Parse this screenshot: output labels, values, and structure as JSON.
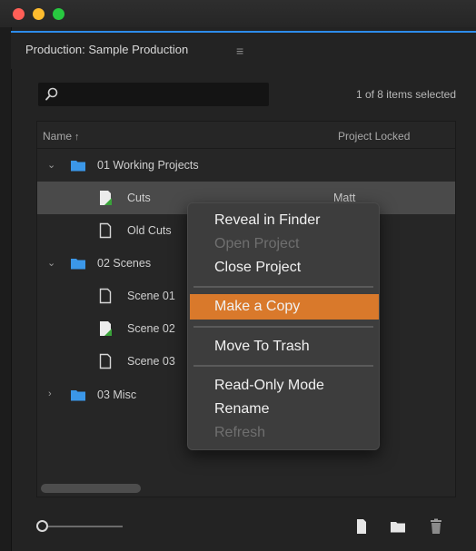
{
  "window": {
    "controls": [
      "close",
      "minimize",
      "zoom"
    ]
  },
  "panel": {
    "title": "Production: Sample Production",
    "menu_icon": "hamburger-menu-icon"
  },
  "search": {
    "placeholder": "",
    "icon": "search-icon"
  },
  "selection_status": "1 of 8 items selected",
  "columns": {
    "name": "Name",
    "name_sort": "↑",
    "locked": "Project Locked"
  },
  "tree": [
    {
      "label": "01 Working Projects",
      "type": "folder",
      "expanded": true,
      "locked": ""
    },
    {
      "label": "Cuts",
      "type": "project-open",
      "locked": "Matt",
      "selected": true
    },
    {
      "label": "Old Cuts",
      "type": "project",
      "locked": ""
    },
    {
      "label": "02 Scenes",
      "type": "folder",
      "expanded": true,
      "locked": ""
    },
    {
      "label": "Scene 01",
      "type": "project",
      "locked": ""
    },
    {
      "label": "Scene 02",
      "type": "project-open",
      "locked": ""
    },
    {
      "label": "Scene 03",
      "type": "project",
      "locked": ""
    },
    {
      "label": "03 Misc",
      "type": "folder",
      "expanded": false,
      "locked": ""
    }
  ],
  "context_menu": {
    "items": [
      {
        "label": "Reveal in Finder",
        "enabled": true
      },
      {
        "label": "Open Project",
        "enabled": false
      },
      {
        "label": "Close Project",
        "enabled": true
      },
      {
        "label": "Make a Copy",
        "enabled": true,
        "highlighted": true
      },
      {
        "label": "Move To Trash",
        "enabled": true
      },
      {
        "label": "Read-Only Mode",
        "enabled": true
      },
      {
        "label": "Rename",
        "enabled": true
      },
      {
        "label": "Refresh",
        "enabled": false
      }
    ]
  },
  "footer": {
    "icons": [
      "new-project-icon",
      "new-folder-icon",
      "trash-icon"
    ]
  },
  "colors": {
    "highlight": "#d9792b",
    "accent": "#2d8ceb",
    "project_open": "#3aa33a"
  }
}
